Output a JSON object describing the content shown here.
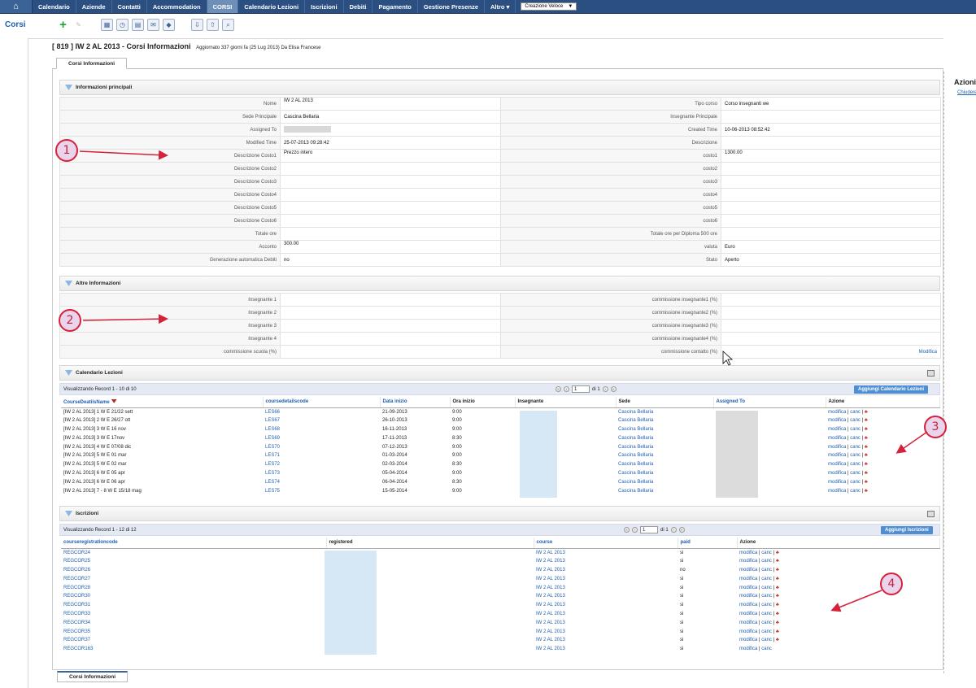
{
  "nav": {
    "items": [
      "Calendario",
      "Aziende",
      "Contatti",
      "Accommodation",
      "CORSI",
      "Calendario Lezioni",
      "Iscrizioni",
      "Debiti",
      "Pagamento",
      "Gestione Presenze",
      "Altro ▾"
    ],
    "active_index": 4,
    "quick_create": "Creazione Veloce"
  },
  "module_title": "Corsi",
  "record": {
    "title": "[ 819 ] IW 2 AL 2013 - Corsi Informazioni",
    "subtitle": "Aggiornato 337 giorni fa (25 Lug 2013) Da Elisa Francese",
    "tab": "Corsi Informazioni"
  },
  "right_panel": {
    "title": "Azioni",
    "link": "Chiudere"
  },
  "main_block": {
    "title": "Informazioni principali",
    "rows": [
      {
        "l1": "Nome",
        "v1": "IW 2 AL 2013",
        "l2": "Tipo corso",
        "v2": "Corso insegnanti we"
      },
      {
        "l1": "Sede Principale",
        "v1": "Cascina Bellaria",
        "l2": "Insegnante Principale",
        "v2": ""
      },
      {
        "l1": "Assigned To",
        "v1": "",
        "l2": "Created Time",
        "v2": "10-06-2013 08:52:42"
      },
      {
        "l1": "Modified Time",
        "v1": "25-07-2013 09:28:42",
        "l2": "Descrizione",
        "v2": ""
      },
      {
        "l1": "Descrizione Costo1",
        "v1": "Prezzo intero",
        "l2": "costo1",
        "v2": "1300.00"
      },
      {
        "l1": "Descrizione Costo2",
        "v1": "",
        "l2": "costo2",
        "v2": ""
      },
      {
        "l1": "Descrizione Costo3",
        "v1": "",
        "l2": "costo3",
        "v2": ""
      },
      {
        "l1": "Descrizione Costo4",
        "v1": "",
        "l2": "costo4",
        "v2": ""
      },
      {
        "l1": "Descrizione Costo5",
        "v1": "",
        "l2": "costo5",
        "v2": ""
      },
      {
        "l1": "Descrizione Costo6",
        "v1": "",
        "l2": "costo6",
        "v2": ""
      },
      {
        "l1": "Totale ore",
        "v1": "",
        "l2": "Totale ore per Diploma 500 ore",
        "v2": ""
      },
      {
        "l1": "Acconto",
        "v1": "300.00",
        "l2": "valuta",
        "v2": "Euro"
      },
      {
        "l1": "Generazione automatica Debiti",
        "v1": "no",
        "l2": "Stato",
        "v2": "Aperto"
      }
    ]
  },
  "other_block": {
    "title": "Altre Informazioni",
    "rows": [
      {
        "l1": "Insegnante 1",
        "l2": "commissione insegnante1 (%)"
      },
      {
        "l1": "Insegnante 2",
        "l2": "commissione insegnante2 (%)"
      },
      {
        "l1": "Insegnante 3",
        "l2": "commissione insegnante3 (%)"
      },
      {
        "l1": "Insegnante 4",
        "l2": "commissione insegnante4 (%)"
      },
      {
        "l1": "commissione scuola (%)",
        "l2": "commissione contatto (%)"
      }
    ],
    "edit_link": "Modifica"
  },
  "lessons": {
    "title": "Calendario Lezioni",
    "records": "Visualizzando Record 1 - 10 di 10",
    "page": "1",
    "of": "di 1",
    "add_button": "Aggiungi Calendario Lezioni",
    "columns": [
      "CourseDeatilsName",
      "coursedetailscode",
      "Data inizio",
      "Ora inizio",
      "Insegnante",
      "Sede",
      "Assigned To",
      "Azione"
    ],
    "rows": [
      [
        "[IW 2 AL 2013] 1 W E 21/22 sett",
        "LES66",
        "21-09-2013",
        "9:00",
        "Cascina Bellaria"
      ],
      [
        "[IW 2 AL 2013] 2 W E 26/27 ott",
        "LES67",
        "26-10-2013",
        "9:00",
        "Cascina Bellaria"
      ],
      [
        "[IW 2 AL 2013] 3 W E 16 nov",
        "LES68",
        "16-11-2013",
        "9:00",
        "Cascina Bellaria"
      ],
      [
        "[IW 2 AL 2013] 3 W E 17nov",
        "LES69",
        "17-11-2013",
        "8:30",
        "Cascina Bellaria"
      ],
      [
        "[IW 2 AL 2013] 4 W E 07/08 dic",
        "LES70",
        "07-12-2013",
        "9:00",
        "Cascina Bellaria"
      ],
      [
        "[IW 2 AL 2013] 5 W E 01 mar",
        "LES71",
        "01-03-2014",
        "9:00",
        "Cascina Bellaria"
      ],
      [
        "[IW 2 AL 2013] 5 W E 02 mar",
        "LES72",
        "02-03-2014",
        "8:30",
        "Cascina Bellaria"
      ],
      [
        "[IW 2 AL 2013] 6 W E 05 apr",
        "LES73",
        "05-04-2014",
        "9:00",
        "Cascina Bellaria"
      ],
      [
        "[IW 2 AL 2013] 6 W E 06 apr",
        "LES74",
        "06-04-2014",
        "8:30",
        "Cascina Bellaria"
      ],
      [
        "[IW 2 AL 2013] 7 - 8 W E 15/18 mag",
        "LES75",
        "15-05-2014",
        "9:00",
        "Cascina Bellaria"
      ]
    ],
    "action_edit": "modifica",
    "action_del": "canc"
  },
  "enrollments": {
    "title": "Iscrizioni",
    "records": "Visualizzando Record 1 - 12 di 12",
    "page": "1",
    "of": "di 1",
    "add_button": "Aggiungi Iscrizioni",
    "columns": [
      "courseregistrationcode",
      "registered",
      "course",
      "paid",
      "Azione"
    ],
    "rows": [
      [
        "REGCOR24",
        "IW 2 AL 2013",
        "si"
      ],
      [
        "REGCOR25",
        "IW 2 AL 2013",
        "si"
      ],
      [
        "REGCOR26",
        "IW 2 AL 2013",
        "no"
      ],
      [
        "REGCOR27",
        "IW 2 AL 2013",
        "si"
      ],
      [
        "REGCOR28",
        "IW 2 AL 2013",
        "si"
      ],
      [
        "REGCOR30",
        "IW 2 AL 2013",
        "si"
      ],
      [
        "REGCOR31",
        "IW 2 AL 2013",
        "si"
      ],
      [
        "REGCOR33",
        "IW 2 AL 2013",
        "si"
      ],
      [
        "REGCOR34",
        "IW 2 AL 2013",
        "si"
      ],
      [
        "REGCOR35",
        "IW 2 AL 2013",
        "si"
      ],
      [
        "REGCOR37",
        "IW 2 AL 2013",
        "si"
      ],
      [
        "REGCOR163",
        "IW 2 AL 2013",
        "si"
      ]
    ],
    "action_edit": "modifica",
    "action_del": "canc"
  },
  "annotations": [
    "1",
    "2",
    "3",
    "4"
  ],
  "colors": {
    "nav": "#2b4f80",
    "link": "#1f5fb0",
    "accent_button": "#4f8ed3",
    "annotation": "#d6213a"
  }
}
